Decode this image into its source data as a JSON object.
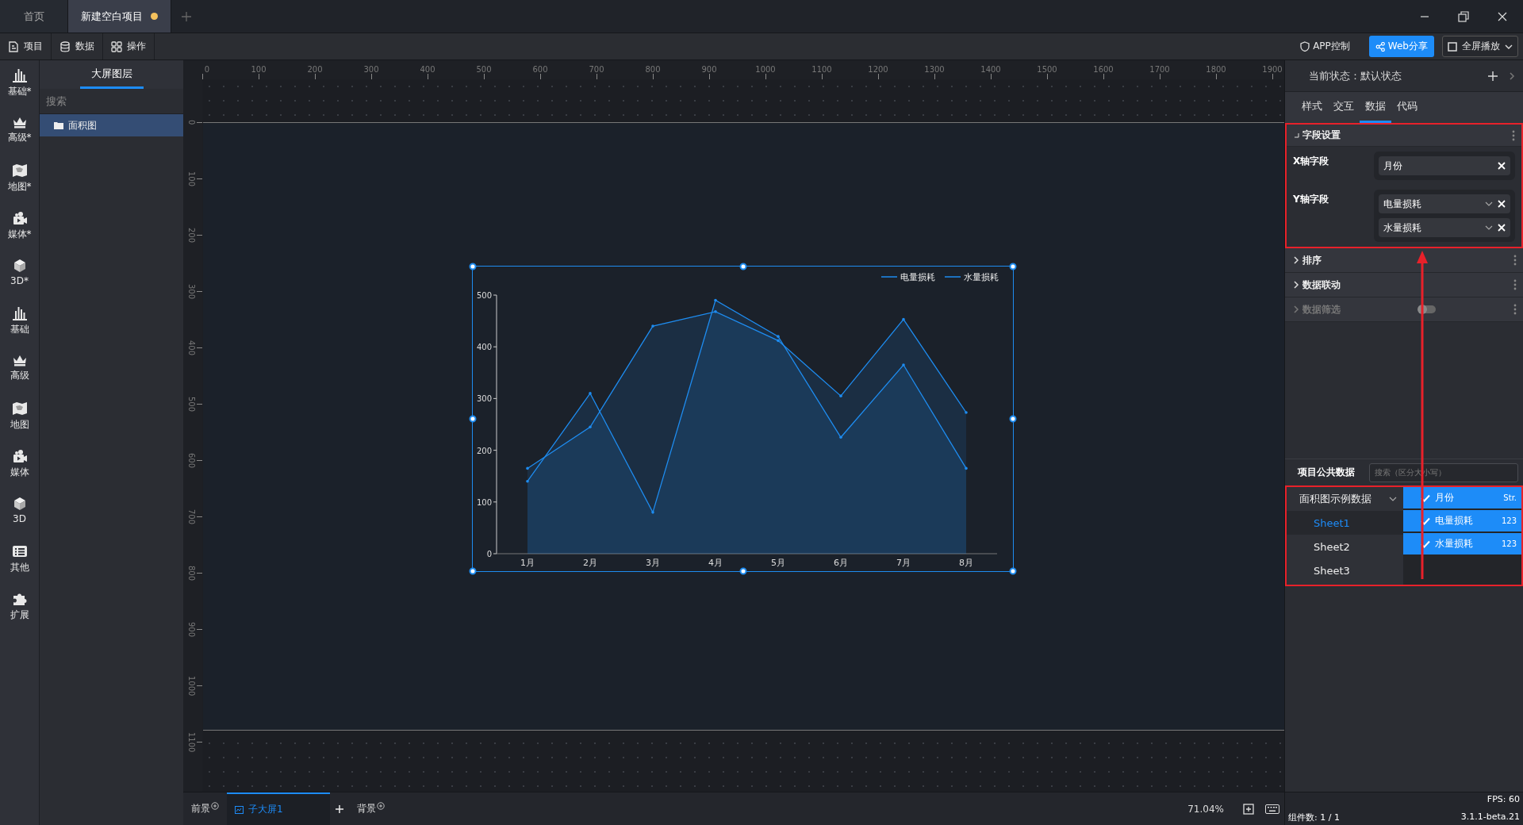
{
  "tabs": [
    {
      "label": "首页",
      "selected": false,
      "unsaved": false
    },
    {
      "label": "新建空白项目",
      "selected": true,
      "unsaved": true
    }
  ],
  "toolbar": {
    "menus": [
      "项目",
      "数据",
      "操作"
    ],
    "app_control": "APP控制",
    "web_share": "Web分享",
    "fullscreen": "全屏播放"
  },
  "component_sidebar": [
    "基础*",
    "高级*",
    "地图*",
    "媒体*",
    "3D*",
    "基础",
    "高级",
    "地图",
    "媒体",
    "3D",
    "其他",
    "扩展"
  ],
  "layers": {
    "tab": "大屏图层",
    "search_placeholder": "搜索",
    "items": [
      {
        "label": "面积图",
        "selected": true
      }
    ]
  },
  "rulers": {
    "horizontal": [
      "0",
      "100",
      "200",
      "300",
      "400",
      "500",
      "600",
      "700",
      "800",
      "900",
      "1000",
      "1100",
      "1200",
      "1300",
      "1400",
      "1500",
      "1600",
      "1700",
      "1800",
      "1900"
    ],
    "vertical": [
      "0",
      "100",
      "200",
      "300",
      "400",
      "500",
      "600",
      "700",
      "800",
      "900",
      "1000",
      "1100"
    ]
  },
  "chart": {
    "chart_data": {
      "type": "area",
      "categories": [
        "1月",
        "2月",
        "3月",
        "4月",
        "5月",
        "6月",
        "7月",
        "8月"
      ],
      "series": [
        {
          "name": "电量损耗",
          "color": "#1e8cf0",
          "values": [
            140,
            310,
            80,
            490,
            420,
            225,
            365,
            165
          ]
        },
        {
          "name": "水量损耗",
          "color": "#1e8cf0",
          "values": [
            165,
            245,
            440,
            468,
            412,
            305,
            453,
            273
          ]
        }
      ],
      "ylim": [
        0,
        500
      ],
      "yticks": [
        0,
        100,
        200,
        300,
        400,
        500
      ],
      "legend": "top-right"
    }
  },
  "bottom_bar": {
    "foreground": "前景",
    "screens": [
      {
        "label": "子大屏1",
        "selected": true
      }
    ],
    "background": "背景",
    "zoom": "71.04%"
  },
  "right_panel": {
    "state": "当前状态：默认状态",
    "tabs": [
      {
        "label": "样式",
        "selected": false
      },
      {
        "label": "交互",
        "selected": false
      },
      {
        "label": "数据",
        "selected": true
      },
      {
        "label": "代码",
        "selected": false
      }
    ],
    "field_section": {
      "title": "字段设置",
      "expanded": true,
      "fields": [
        {
          "label": "X轴字段",
          "values": [
            {
              "text": "月份",
              "dropdown": false
            }
          ]
        },
        {
          "label": "Y轴字段",
          "values": [
            {
              "text": "电量损耗",
              "dropdown": true
            },
            {
              "text": "水量损耗",
              "dropdown": true
            }
          ]
        }
      ]
    },
    "sections": [
      {
        "title": "排序",
        "disabled": false,
        "toggle": false
      },
      {
        "title": "数据联动",
        "disabled": false,
        "toggle": false
      },
      {
        "title": "数据筛选",
        "disabled": true,
        "toggle": true,
        "toggle_on": false
      }
    ],
    "public_data": {
      "title": "项目公共数据",
      "search_placeholder": "搜索（区分大小写）",
      "dataset": {
        "name": "面积图示例数据",
        "expanded": true,
        "sheets": [
          {
            "label": "Sheet1",
            "selected": true
          },
          {
            "label": "Sheet2",
            "selected": false
          },
          {
            "label": "Sheet3",
            "selected": false
          }
        ]
      },
      "columns": [
        {
          "name": "月份",
          "type": "Str.",
          "checked": true
        },
        {
          "name": "电量损耗",
          "type": "123",
          "checked": true
        },
        {
          "name": "水量损耗",
          "type": "123",
          "checked": true
        }
      ]
    },
    "fps": "FPS: 60",
    "component_count": "组件数: 1 / 1",
    "version": "3.1.1-beta.21"
  }
}
